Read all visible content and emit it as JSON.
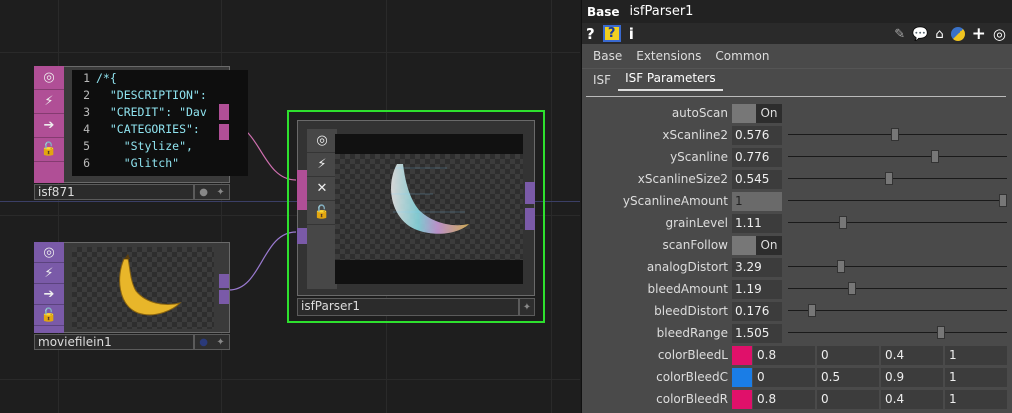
{
  "network": {
    "isf_node": {
      "name": "isf871",
      "code": [
        {
          "n": "1",
          "text": "/*{"
        },
        {
          "n": "2",
          "text": "  \"DESCRIPTION\":"
        },
        {
          "n": "3",
          "text": "  \"CREDIT\": \"Dav"
        },
        {
          "n": "4",
          "text": "  \"CATEGORIES\":"
        },
        {
          "n": "5",
          "text": "    \"Stylize\","
        },
        {
          "n": "6",
          "text": "    \"Glitch\""
        }
      ]
    },
    "movie_node": {
      "name": "moviefilein1"
    },
    "parser_node": {
      "name": "isfParser1"
    }
  },
  "panel": {
    "title_type": "Base",
    "title_name": "isfParser1",
    "page_tabs": [
      "Base",
      "Extensions",
      "Common"
    ],
    "sub_tabs": [
      "ISF",
      "ISF Parameters"
    ],
    "active_sub_tab": "ISF Parameters",
    "params": [
      {
        "label": "autoScan",
        "kind": "toggle",
        "value": "On"
      },
      {
        "label": "xScanline2",
        "kind": "slider",
        "value": "0.576",
        "level": 0.49
      },
      {
        "label": "yScanline",
        "kind": "slider",
        "value": "0.776",
        "level": 0.67
      },
      {
        "label": "xScanlineSize2",
        "kind": "slider",
        "value": "0.545",
        "level": 0.46
      },
      {
        "label": "yScanlineAmount",
        "kind": "slider-disabled",
        "value": "1",
        "level": 1.0
      },
      {
        "label": "grainLevel",
        "kind": "slider",
        "value": "1.11",
        "level": 0.25
      },
      {
        "label": "scanFollow",
        "kind": "toggle",
        "value": "On"
      },
      {
        "label": "analogDistort",
        "kind": "slider",
        "value": "3.29",
        "level": 0.24
      },
      {
        "label": "bleedAmount",
        "kind": "slider",
        "value": "1.19",
        "level": 0.29
      },
      {
        "label": "bleedDistort",
        "kind": "slider",
        "value": "0.176",
        "level": 0.11
      },
      {
        "label": "bleedRange",
        "kind": "slider",
        "value": "1.505",
        "level": 0.7
      },
      {
        "label": "colorBleedL",
        "kind": "color",
        "swatch": "#e0106a",
        "values": [
          "0.8",
          "0",
          "0.4",
          "1"
        ]
      },
      {
        "label": "colorBleedC",
        "kind": "color",
        "swatch": "#1a7de6",
        "values": [
          "0",
          "0.5",
          "0.9",
          "1"
        ]
      },
      {
        "label": "colorBleedR",
        "kind": "color",
        "swatch": "#e0106a",
        "values": [
          "0.8",
          "0",
          "0.4",
          "1"
        ]
      }
    ]
  },
  "colors": {
    "selected_border": "#2ee02e",
    "dat_strip": "#b04f96",
    "top_strip": "#7a5aa8",
    "wire_pink": "#d070b0",
    "wire_violet": "#9a7ad0"
  }
}
